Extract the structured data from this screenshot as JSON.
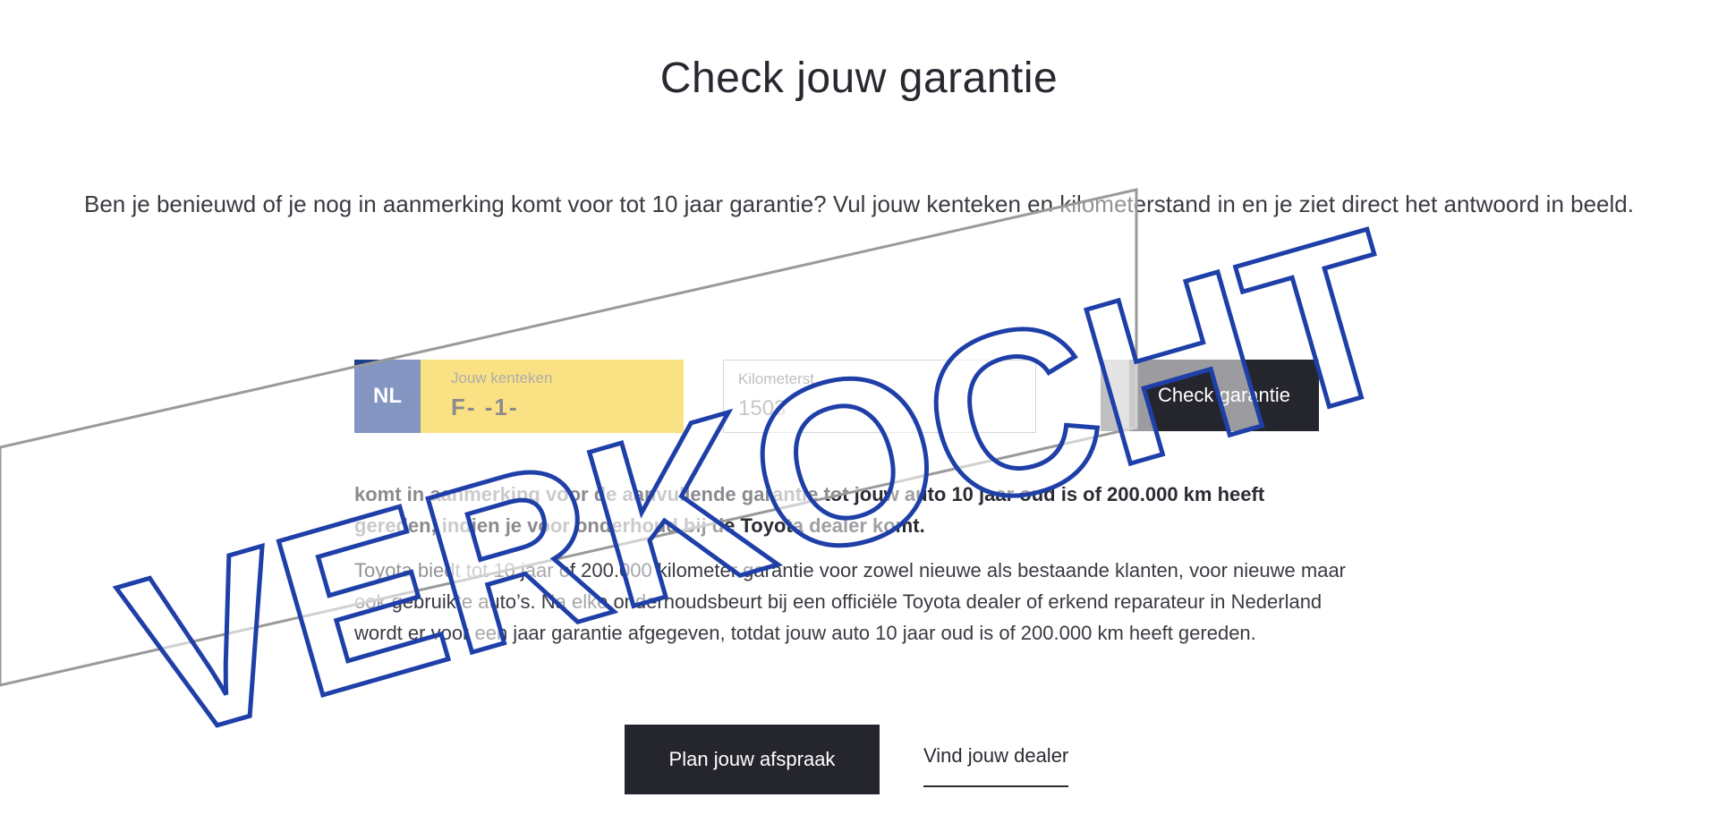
{
  "page": {
    "title": "Check jouw garantie",
    "intro": "Ben je benieuwd of je nog in aanmerking komt voor tot 10 jaar garantie? Vul jouw kenteken en kilometerstand in en je ziet direct het antwoord in beeld."
  },
  "form": {
    "country_code": "NL",
    "plate_label": "Jouw kenteken",
    "plate_value": "F- -1-",
    "km_label": "Kilometerst",
    "km_value": "1503",
    "submit_label": "Check garantie"
  },
  "info": {
    "bold_text": "komt in aanmerking voor de aanvullende garantie tot jouw auto 10 jaar oud is of 200.000 km heeft gereden, indien je voor onderhoud bij de Toyota dealer komt.",
    "body_text": "Toyota biedt tot 10 jaar of 200.000 kilometer garantie voor zowel nieuwe als bestaande klanten, voor nieuwe maar ook gebruikte auto’s. Na elke onderhoudsbeurt bij een officiële Toyota dealer of erkend reparateur in Nederland wordt er voor een jaar garantie afgegeven, totdat jouw auto 10 jaar oud is of 200.000 km heeft gereden."
  },
  "actions": {
    "plan_label": "Plan jouw afspraak",
    "dealer_label": "Vind jouw dealer"
  },
  "stamp": {
    "text": "VERKOCHT",
    "color": "#1f3fa8"
  },
  "colors": {
    "plate_blue": "#1e3f8c",
    "plate_yellow": "#f6c81e",
    "button_dark": "#25252d"
  }
}
